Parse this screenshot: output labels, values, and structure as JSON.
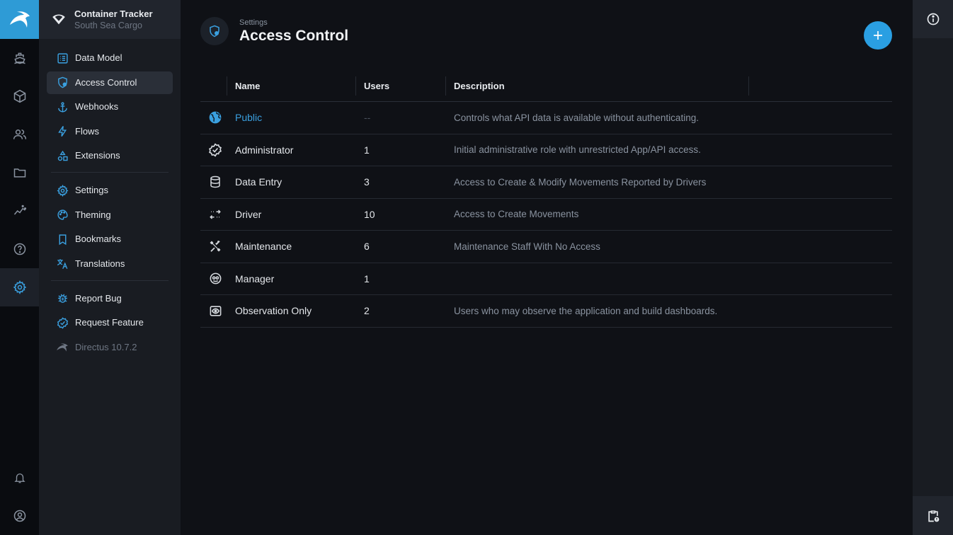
{
  "project": {
    "name": "Container Tracker",
    "org": "South Sea Cargo"
  },
  "modules": [
    {
      "icon": "ship-icon",
      "name": "module-content"
    },
    {
      "icon": "cube-icon",
      "name": "module-files-cube"
    },
    {
      "icon": "users-icon",
      "name": "module-users"
    },
    {
      "icon": "folder-icon",
      "name": "module-files"
    },
    {
      "icon": "insights-icon",
      "name": "module-insights"
    },
    {
      "icon": "help-icon",
      "name": "module-docs"
    },
    {
      "icon": "gear-icon",
      "name": "module-settings",
      "active": true
    }
  ],
  "nav": {
    "items": [
      {
        "label": "Data Model",
        "icon": "list-icon"
      },
      {
        "label": "Access Control",
        "icon": "shield-icon",
        "active": true
      },
      {
        "label": "Webhooks",
        "icon": "anchor-icon"
      },
      {
        "label": "Flows",
        "icon": "bolt-icon"
      },
      {
        "label": "Extensions",
        "icon": "shapes-icon"
      }
    ],
    "items2": [
      {
        "label": "Settings",
        "icon": "gear-icon"
      },
      {
        "label": "Theming",
        "icon": "palette-icon"
      },
      {
        "label": "Bookmarks",
        "icon": "bookmark-icon"
      },
      {
        "label": "Translations",
        "icon": "translate-icon"
      }
    ],
    "items3": [
      {
        "label": "Report Bug",
        "icon": "bug-icon"
      },
      {
        "label": "Request Feature",
        "icon": "check-badge-icon"
      },
      {
        "label": "Directus 10.7.2",
        "icon": "rabbit-icon"
      }
    ]
  },
  "header": {
    "breadcrumb": "Settings",
    "title": "Access Control"
  },
  "table": {
    "columns": [
      "Name",
      "Users",
      "Description"
    ],
    "rows": [
      {
        "name": "Public",
        "users": "--",
        "description": "Controls what API data is available without authenticating.",
        "icon": "globe-icon"
      },
      {
        "name": "Administrator",
        "users": "1",
        "description": "Initial administrative role with unrestricted App/API access.",
        "icon": "verified-icon"
      },
      {
        "name": "Data Entry",
        "users": "3",
        "description": "Access to Create & Modify Movements Reported by Drivers",
        "icon": "database-icon"
      },
      {
        "name": "Driver",
        "users": "10",
        "description": "Access to Create Movements",
        "icon": "swap-icon"
      },
      {
        "name": "Maintenance",
        "users": "6",
        "description": "Maintenance Staff With No Access",
        "icon": "tools-icon"
      },
      {
        "name": "Manager",
        "users": "1",
        "description": "",
        "icon": "face-icon"
      },
      {
        "name": "Observation Only",
        "users": "2",
        "description": "Users who may observe the application and build dashboards.",
        "icon": "eye-icon"
      }
    ]
  },
  "colors": {
    "accent": "#2a9fe2",
    "background": "#0f1116",
    "nav": "#191c22"
  }
}
